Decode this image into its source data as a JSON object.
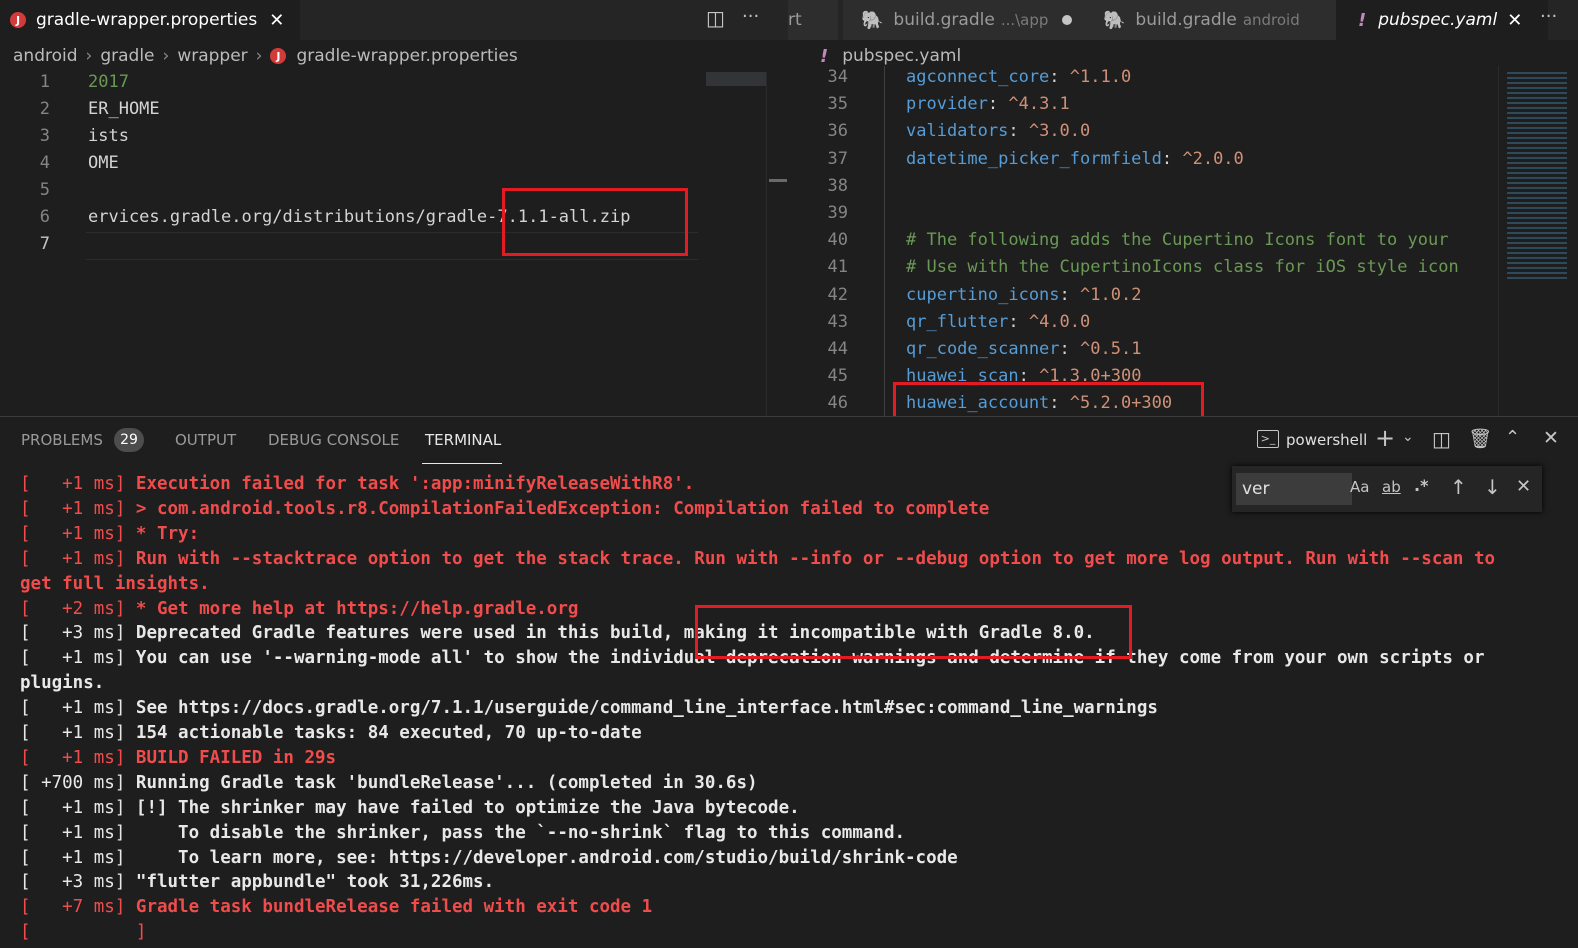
{
  "left_editor": {
    "tab": {
      "filename": "gradle-wrapper.properties",
      "close": "✕"
    },
    "tab_actions": {
      "split": "◫",
      "more": "···"
    },
    "breadcrumb": [
      "android",
      "gradle",
      "wrapper",
      "gradle-wrapper.properties"
    ],
    "lines": [
      {
        "num": "1",
        "text": "2017"
      },
      {
        "num": "2",
        "text": "ER_HOME"
      },
      {
        "num": "3",
        "text": "ists"
      },
      {
        "num": "4",
        "text": "OME"
      },
      {
        "num": "5",
        "text": ""
      },
      {
        "num": "6",
        "text": "ervices.gradle.org/distributions/gradle-7.1.1-all.zip"
      },
      {
        "num": "7",
        "text": ""
      }
    ]
  },
  "right_editor": {
    "tabs": [
      {
        "label": "rt",
        "sub": ""
      },
      {
        "label": "build.gradle",
        "sub": "...\\app"
      },
      {
        "label": "build.gradle",
        "sub": "android"
      },
      {
        "label": "pubspec.yaml",
        "sub": ""
      }
    ],
    "tab_close": "✕",
    "tab_more": "···",
    "breadcrumb_file": "pubspec.yaml",
    "lines": [
      {
        "num": "34",
        "key": "agconnect_core",
        "val": "^1.1.0"
      },
      {
        "num": "35",
        "key": "provider",
        "val": "^4.3.1"
      },
      {
        "num": "36",
        "key": "validators",
        "val": "^3.0.0"
      },
      {
        "num": "37",
        "key": "datetime_picker_formfield",
        "val": "^2.0.0"
      },
      {
        "num": "38",
        "key": "",
        "val": ""
      },
      {
        "num": "39",
        "key": "",
        "val": ""
      },
      {
        "num": "40",
        "comment": "# The following adds the Cupertino Icons font to your"
      },
      {
        "num": "41",
        "comment": "# Use with the CupertinoIcons class for iOS style icon"
      },
      {
        "num": "42",
        "key": "cupertino_icons",
        "val": "^1.0.2"
      },
      {
        "num": "43",
        "key": "qr_flutter",
        "val": "^4.0.0"
      },
      {
        "num": "44",
        "key": "qr_code_scanner",
        "val": "^0.5.1"
      },
      {
        "num": "45",
        "key": "huawei_scan",
        "val": "^1.3.0+300"
      },
      {
        "num": "46",
        "key": "huawei_account",
        "val": "^5.2.0+300"
      }
    ]
  },
  "panel": {
    "tabs": [
      "PROBLEMS",
      "OUTPUT",
      "DEBUG CONSOLE",
      "TERMINAL"
    ],
    "problems_count": "29",
    "shell": "powershell",
    "find": {
      "value": "ver",
      "match_case": "Aa",
      "whole_word": "ab",
      "regex": ".*"
    },
    "terminal_lines": [
      {
        "prefix": "[   +1 ms] ",
        "text": "Execution failed for task ':app:minifyReleaseWithR8'.",
        "color": "red"
      },
      {
        "prefix": "[   +1 ms] ",
        "text": "> com.android.tools.r8.CompilationFailedException: Compilation failed to complete",
        "color": "red"
      },
      {
        "prefix": "[   +1 ms] ",
        "text": "* Try:",
        "color": "red"
      },
      {
        "prefix": "[   +1 ms] ",
        "text": "Run with --stacktrace option to get the stack trace. Run with --info or --debug option to get more log output. Run with --scan to",
        "color": "red"
      },
      {
        "prefix": "",
        "text": "get full insights.",
        "color": "red"
      },
      {
        "prefix": "[   +2 ms] ",
        "text": "* Get more help at https://help.gradle.org",
        "color": "red"
      },
      {
        "prefix": "[   +3 ms] ",
        "text": "Deprecated Gradle features were used in this build, making it incompatible with Gradle 8.0.",
        "color": "white"
      },
      {
        "prefix": "[   +1 ms] ",
        "text": "You can use '--warning-mode all' to show the individual deprecation warnings and determine if they come from your own scripts or",
        "color": "white"
      },
      {
        "prefix": "",
        "text": "plugins.",
        "color": "white"
      },
      {
        "prefix": "[   +1 ms] ",
        "text": "See https://docs.gradle.org/7.1.1/userguide/command_line_interface.html#sec:command_line_warnings",
        "color": "white"
      },
      {
        "prefix": "[   +1 ms] ",
        "text": "154 actionable tasks: 84 executed, 70 up-to-date",
        "color": "white"
      },
      {
        "prefix": "[   +1 ms] ",
        "text": "BUILD FAILED in 29s",
        "color": "red"
      },
      {
        "prefix": "[ +700 ms] ",
        "text": "Running Gradle task 'bundleRelease'... (completed in 30.6s)",
        "color": "white"
      },
      {
        "prefix": "[   +1 ms] ",
        "text": "[!] The shrinker may have failed to optimize the Java bytecode.",
        "color": "white"
      },
      {
        "prefix": "[   +1 ms] ",
        "text": "    To disable the shrinker, pass the `--no-shrink` flag to this command.",
        "color": "white"
      },
      {
        "prefix": "[   +1 ms] ",
        "text": "    To learn more, see: https://developer.android.com/studio/build/shrink-code",
        "color": "white"
      },
      {
        "prefix": "[   +3 ms] ",
        "text": "\"flutter appbundle\" took 31,226ms.",
        "color": "white"
      },
      {
        "prefix": "[   +7 ms] ",
        "text": "Gradle task bundleRelease failed with exit code 1",
        "color": "red"
      },
      {
        "prefix": "[          ]",
        "text": "",
        "color": "red"
      }
    ]
  },
  "colors": {
    "accent_red": "#e51b24",
    "key_blue": "#569cd6",
    "value_orange": "#ce9178",
    "comment_green": "#6a9955",
    "terminal_red": "#f14c4c"
  }
}
